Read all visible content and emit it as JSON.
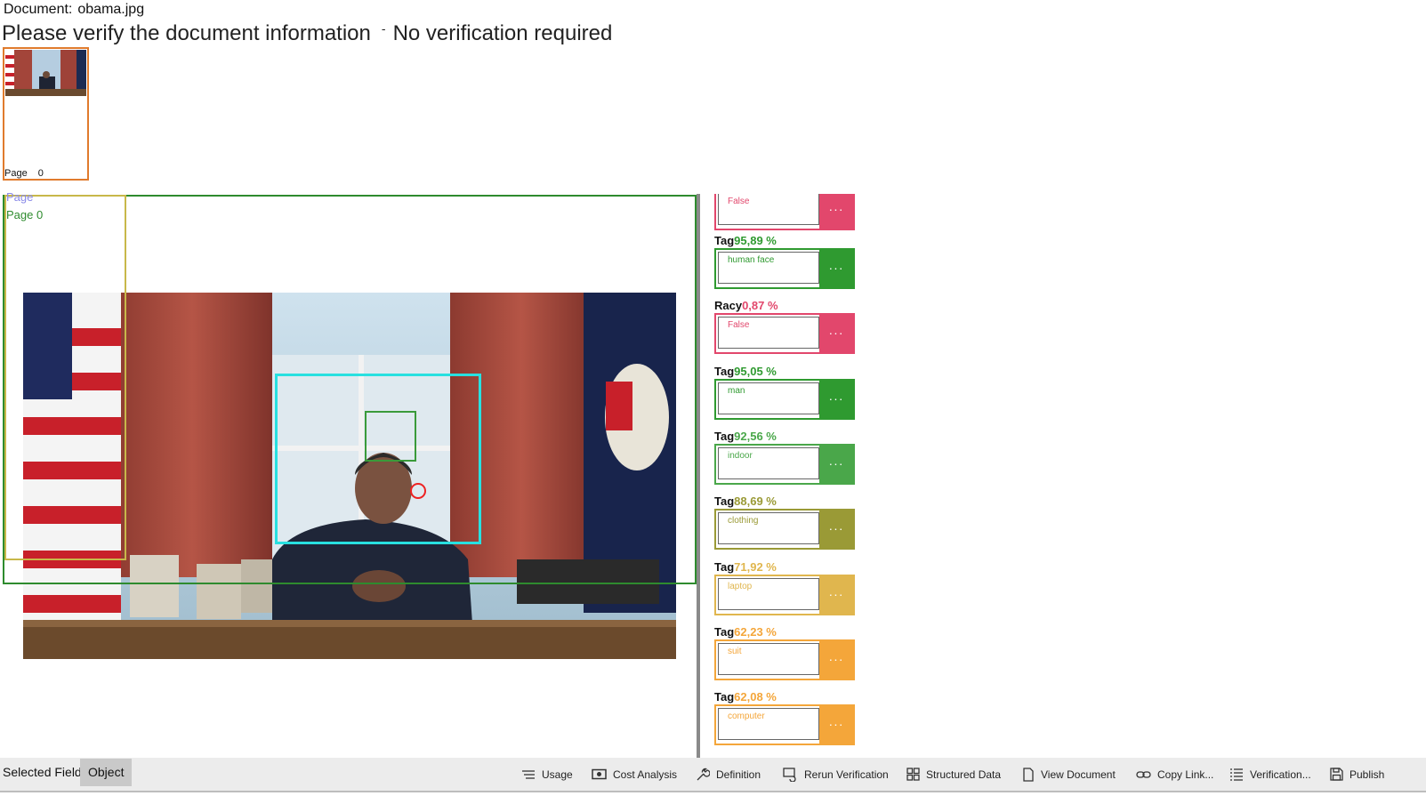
{
  "document": {
    "label": "Document:",
    "filename": "obama.jpg"
  },
  "verify": {
    "prompt": "Please verify the document information",
    "separator": "-",
    "status": "No verification required"
  },
  "thumbnail": {
    "page_label": "Page",
    "page_number": "0"
  },
  "viewer": {
    "page_label_a": "Page",
    "page_label_b": "Page 0"
  },
  "fields": [
    {
      "name": "",
      "pct": "",
      "value": "False",
      "color": "#e2476c"
    },
    {
      "name": "Tag",
      "pct": "95,89 %",
      "value": "human face",
      "color": "#2f9a30"
    },
    {
      "name": "Racy",
      "pct": "0,87 %",
      "value": "False",
      "color": "#e2476c"
    },
    {
      "name": "Tag",
      "pct": "95,05 %",
      "value": "man",
      "color": "#2f9a30"
    },
    {
      "name": "Tag",
      "pct": "92,56 %",
      "value": "indoor",
      "color": "#4aa74a"
    },
    {
      "name": "Tag",
      "pct": "88,69 %",
      "value": "clothing",
      "color": "#9a9a36"
    },
    {
      "name": "Tag",
      "pct": "71,92 %",
      "value": "laptop",
      "color": "#e0b64e"
    },
    {
      "name": "Tag",
      "pct": "62,23 %",
      "value": "suit",
      "color": "#f4a63a"
    },
    {
      "name": "Tag",
      "pct": "62,08 %",
      "value": "computer",
      "color": "#f4a63a"
    }
  ],
  "more_glyph": "···",
  "toolbar": {
    "selected_label": "Selected Field:",
    "selected_value": "Object",
    "buttons": [
      {
        "label": "Usage",
        "icon": "list-icon"
      },
      {
        "label": "Cost Analysis",
        "icon": "money-icon"
      },
      {
        "label": "Definition",
        "icon": "wrench-icon"
      },
      {
        "label": "Rerun Verification",
        "icon": "rerun-icon"
      },
      {
        "label": "Structured Data",
        "icon": "grid-icon"
      },
      {
        "label": "View Document",
        "icon": "document-icon"
      },
      {
        "label": "Copy Link...",
        "icon": "link-icon"
      },
      {
        "label": "Verification...",
        "icon": "checklist-icon"
      },
      {
        "label": "Publish",
        "icon": "save-icon"
      }
    ]
  }
}
